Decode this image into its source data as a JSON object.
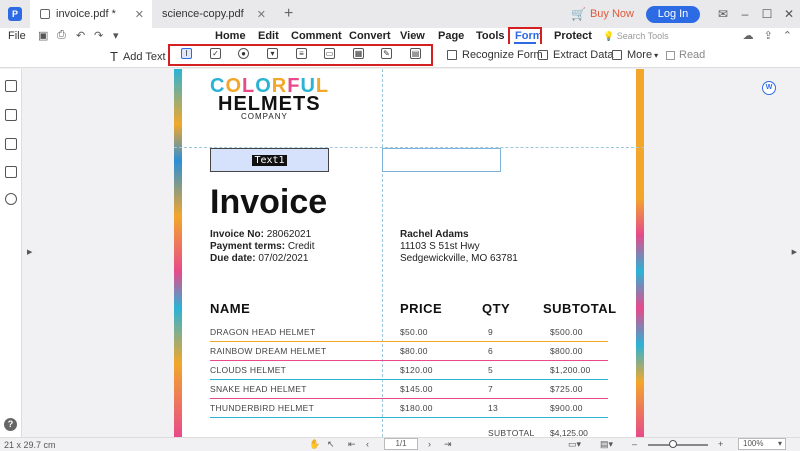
{
  "tabs": [
    {
      "label": "invoice.pdf *",
      "active": true
    },
    {
      "label": "science-copy.pdf",
      "active": false
    }
  ],
  "titlebar": {
    "buy_now": "Buy Now",
    "login": "Log In"
  },
  "menu": {
    "file": "File",
    "items": [
      "Home",
      "Edit",
      "Comment",
      "Convert",
      "View",
      "Page",
      "Tools",
      "Form",
      "Protect"
    ],
    "search_placeholder": "Search Tools"
  },
  "toolbar": {
    "add_text": "Add Text",
    "form_tools": [
      "text-field",
      "checkbox",
      "radio",
      "combo",
      "list",
      "button",
      "image",
      "signature",
      "date"
    ],
    "recognize_form": "Recognize Form",
    "extract_data": "Extract Data",
    "more": "More",
    "read": "Read"
  },
  "document": {
    "logo_word1": "COLORFUL",
    "logo_word2": "HELMETS",
    "logo_word3": "COMPANY",
    "field1_label": "Text1",
    "title": "Invoice",
    "invoice_no_label": "Invoice No:",
    "invoice_no": "28062021",
    "payment_label": "Payment terms:",
    "payment": "Credit",
    "due_label": "Due date:",
    "due": "07/02/2021",
    "bill_name": "Rachel Adams",
    "bill_addr1": "11103 S 51st Hwy",
    "bill_addr2": "Sedgewickville, MO 63781",
    "headers": [
      "NAME",
      "PRICE",
      "QTY",
      "SUBTOTAL"
    ],
    "rows": [
      {
        "name": "DRAGON HEAD HELMET",
        "price": "$50.00",
        "qty": "9",
        "subtotal": "$500.00"
      },
      {
        "name": "RAINBOW DREAM HELMET",
        "price": "$80.00",
        "qty": "6",
        "subtotal": "$800.00"
      },
      {
        "name": "CLOUDS HELMET",
        "price": "$120.00",
        "qty": "5",
        "subtotal": "$1,200.00"
      },
      {
        "name": "SNAKE HEAD HELMET",
        "price": "$145.00",
        "qty": "7",
        "subtotal": "$725.00"
      },
      {
        "name": "THUNDERBIRD HELMET",
        "price": "$180.00",
        "qty": "13",
        "subtotal": "$900.00"
      }
    ],
    "subtotal_label": "SUBTOTAL",
    "subtotal_value": "$4,125.00"
  },
  "status": {
    "page_size": "21 x 29.7 cm",
    "page_indicator": "1/1",
    "zoom": "100%"
  },
  "colors": {
    "accent": "#2d6be4",
    "highlight_red": "#d42020",
    "logo_c1": "#2bb3d6",
    "logo_c2": "#f2a72b",
    "logo_c3": "#e84a8a"
  }
}
